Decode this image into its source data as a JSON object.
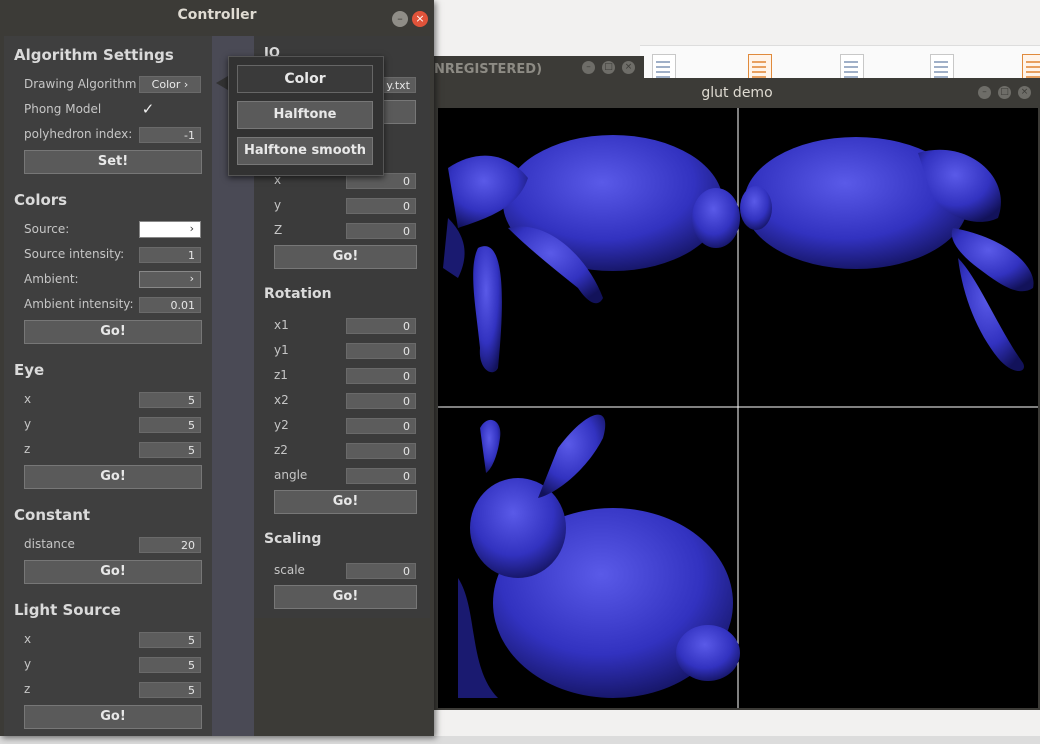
{
  "controller": {
    "title": "Controller",
    "left": {
      "algorithm": {
        "heading": "Algorithm Settings",
        "drawing_label": "Drawing Algorithm",
        "drawing_value": "Color",
        "phong_label": "Phong Model",
        "phong_checked": "✓",
        "poly_label": "polyhedron index:",
        "poly_value": "-1",
        "set_label": "Set!"
      },
      "colors": {
        "heading": "Colors",
        "source_label": "Source:",
        "source_color": "#ffffff",
        "intensity_label": "Source intensity:",
        "intensity_value": "1",
        "ambient_label": "Ambient:",
        "ambient_color": "#5c5c5c",
        "ambient_int_label": "Ambient intensity:",
        "ambient_int_value": "0.01",
        "go": "Go!"
      },
      "eye": {
        "heading": "Eye",
        "x_label": "x",
        "x": "5",
        "y_label": "y",
        "y": "5",
        "z_label": "z",
        "z": "5",
        "go": "Go!"
      },
      "constant": {
        "heading": "Constant",
        "distance_label": "distance",
        "distance": "20",
        "go": "Go!"
      },
      "light": {
        "heading": "Light Source",
        "x_label": "x",
        "x": "5",
        "y_label": "y",
        "y": "5",
        "z_label": "z",
        "z": "5",
        "go": "Go!"
      }
    },
    "right": {
      "io": {
        "heading": "IO",
        "file_value": "y.txt"
      },
      "translation": {
        "x_label": "x",
        "x": "0",
        "y_label": "y",
        "y": "0",
        "z_label": "Z",
        "z": "0",
        "go": "Go!"
      },
      "rotation": {
        "heading": "Rotation",
        "x1_label": "x1",
        "x1": "0",
        "y1_label": "y1",
        "y1": "0",
        "z1_label": "z1",
        "z1": "0",
        "x2_label": "x2",
        "x2": "0",
        "y2_label": "y2",
        "y2": "0",
        "z2_label": "z2",
        "z2": "0",
        "angle_label": "angle",
        "angle": "0",
        "go": "Go!"
      },
      "scaling": {
        "heading": "Scaling",
        "scale_label": "scale",
        "scale": "0",
        "go": "Go!"
      }
    },
    "popup": {
      "options": [
        "Color",
        "Halftone",
        "Halftone smooth"
      ],
      "selected": "Color"
    }
  },
  "background_window": {
    "title": "NREGISTERED)"
  },
  "glut": {
    "title": "glut demo",
    "model_color": "#3535c8"
  }
}
